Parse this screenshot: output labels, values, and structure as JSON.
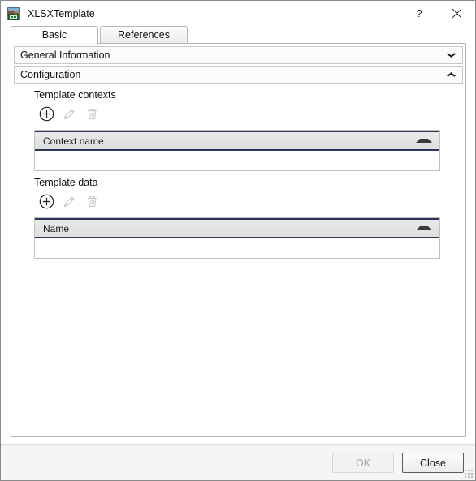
{
  "window": {
    "title": "XLSXTemplate",
    "icon": "xlsx-template-icon",
    "help_label": "?",
    "close_label": "✕"
  },
  "tabs": [
    {
      "label": "Basic",
      "active": true
    },
    {
      "label": "References",
      "active": false
    }
  ],
  "sections": [
    {
      "label": "General Information",
      "expanded": false,
      "chevron": "chevron-down-icon"
    },
    {
      "label": "Configuration",
      "expanded": true,
      "chevron": "chevron-up-icon"
    }
  ],
  "groups": [
    {
      "title": "Template contexts",
      "toolbar": [
        {
          "name": "add-icon",
          "label": "Add",
          "enabled": true
        },
        {
          "name": "edit-pencil-icon",
          "label": "Edit",
          "enabled": false
        },
        {
          "name": "delete-trash-icon",
          "label": "Delete",
          "enabled": false
        }
      ],
      "table": {
        "columns": [
          "Context name"
        ],
        "sort": "ascending",
        "rows": []
      }
    },
    {
      "title": "Template data",
      "toolbar": [
        {
          "name": "add-icon",
          "label": "Add",
          "enabled": true
        },
        {
          "name": "edit-pencil-icon",
          "label": "Edit",
          "enabled": false
        },
        {
          "name": "delete-trash-icon",
          "label": "Delete",
          "enabled": false
        }
      ],
      "table": {
        "columns": [
          "Name"
        ],
        "sort": "ascending",
        "rows": []
      }
    }
  ],
  "footer": {
    "ok_label": "OK",
    "ok_enabled": false,
    "close_label": "Close",
    "close_enabled": true
  },
  "colors": {
    "window_bg": "#ffffff",
    "footer_bg": "#f5f5f5",
    "table_header_bg": "#e4e4e4",
    "table_header_accent": "#2c3558",
    "border": "#b4b4b4",
    "disabled_text": "#a6a6a6"
  }
}
